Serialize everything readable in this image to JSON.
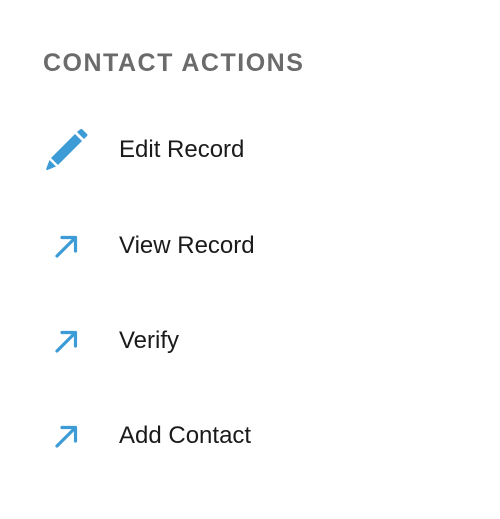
{
  "section": {
    "title": "CONTACT ACTIONS"
  },
  "accent_color": "#3d9bd6",
  "actions": [
    {
      "label": "Edit Record",
      "icon": "pencil-icon"
    },
    {
      "label": "View Record",
      "icon": "arrow-up-right-icon"
    },
    {
      "label": "Verify",
      "icon": "arrow-up-right-icon"
    },
    {
      "label": "Add Contact",
      "icon": "arrow-up-right-icon"
    }
  ]
}
